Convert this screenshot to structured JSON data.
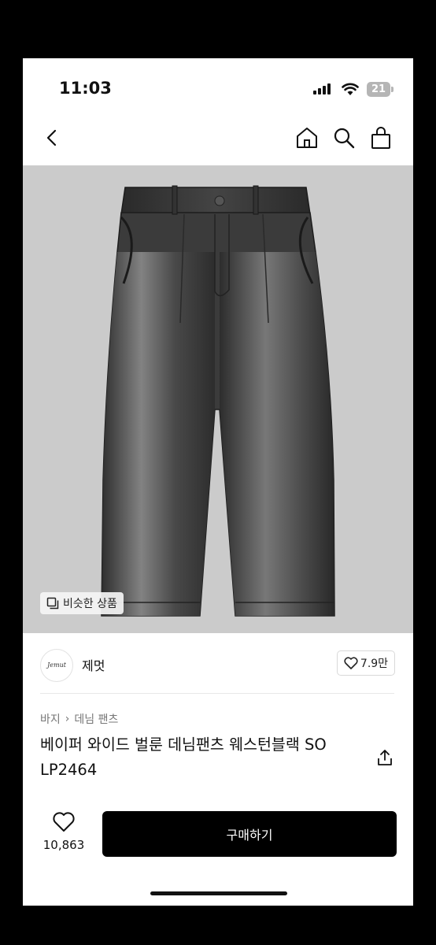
{
  "status_bar": {
    "time": "11:03",
    "battery": "21"
  },
  "nav": {
    "back_icon": "chevron-left-icon",
    "icons": [
      "home-icon",
      "search-icon",
      "shopping-bag-icon"
    ]
  },
  "product_image": {
    "alt_subject": "dark gray faded wide denim pants",
    "similar_button": "비슷한 상품"
  },
  "seller": {
    "logo_text": "Jemut",
    "name": "제멋",
    "likes": "7.9만"
  },
  "breadcrumb": [
    "바지",
    "데님 팬츠"
  ],
  "product": {
    "title": "베이퍼 와이드 벌룬 데님팬츠 웨스턴블랙 SO LP2464"
  },
  "bottom_bar": {
    "favorite_count": "10,863",
    "buy_label": "구매하기"
  },
  "colors": {
    "buy_button": "#000000",
    "image_bg": "#cbcbcb",
    "denim": "#3a3a3a"
  }
}
